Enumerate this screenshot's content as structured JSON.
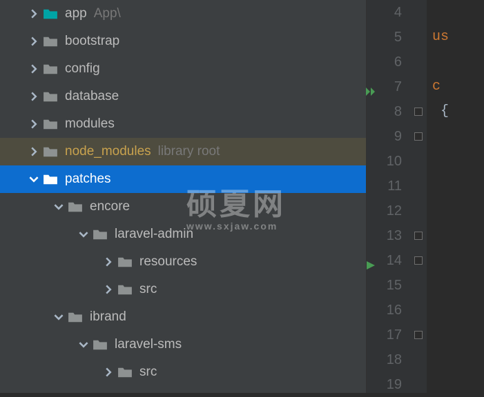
{
  "tree": {
    "items": [
      {
        "label": "app",
        "suffix": "App\\",
        "icon": "teal",
        "arrow": "right",
        "indent": 0
      },
      {
        "label": "bootstrap",
        "suffix": "",
        "icon": "gray",
        "arrow": "right",
        "indent": 0
      },
      {
        "label": "config",
        "suffix": "",
        "icon": "gray",
        "arrow": "right",
        "indent": 0
      },
      {
        "label": "database",
        "suffix": "",
        "icon": "gray",
        "arrow": "right",
        "indent": 0
      },
      {
        "label": "modules",
        "suffix": "",
        "icon": "gray",
        "arrow": "right",
        "indent": 0
      },
      {
        "label": "node_modules",
        "suffix": "library root",
        "icon": "gray",
        "arrow": "right",
        "indent": 0,
        "highlighted": true
      },
      {
        "label": "patches",
        "suffix": "",
        "icon": "gray",
        "arrow": "down",
        "indent": 0,
        "selected": true
      },
      {
        "label": "encore",
        "suffix": "",
        "icon": "gray",
        "arrow": "down",
        "indent": 1
      },
      {
        "label": "laravel-admin",
        "suffix": "",
        "icon": "gray",
        "arrow": "down",
        "indent": 2
      },
      {
        "label": "resources",
        "suffix": "",
        "icon": "gray",
        "arrow": "right",
        "indent": 3
      },
      {
        "label": "src",
        "suffix": "",
        "icon": "gray",
        "arrow": "right",
        "indent": 3
      },
      {
        "label": "ibrand",
        "suffix": "",
        "icon": "gray",
        "arrow": "down",
        "indent": 1
      },
      {
        "label": "laravel-sms",
        "suffix": "",
        "icon": "gray",
        "arrow": "down",
        "indent": 2
      },
      {
        "label": "src",
        "suffix": "",
        "icon": "gray",
        "arrow": "right",
        "indent": 3
      }
    ]
  },
  "editor": {
    "lines": [
      "4",
      "5",
      "6",
      "7",
      "8",
      "9",
      "10",
      "11",
      "12",
      "13",
      "14",
      "15",
      "16",
      "17",
      "18",
      "19"
    ],
    "runMarkers": {
      "7": "double-green",
      "14": "green"
    },
    "code": {
      "4": "",
      "5": "us",
      "6": "",
      "7": "c",
      "8": "{",
      "9": "",
      "10": "",
      "11": "",
      "12": "",
      "13": "",
      "14": "",
      "15": "",
      "16": "",
      "17": "",
      "18": "",
      "19": ""
    }
  },
  "watermark": {
    "big": "硕夏网",
    "small": "www.sxjaw.com"
  }
}
